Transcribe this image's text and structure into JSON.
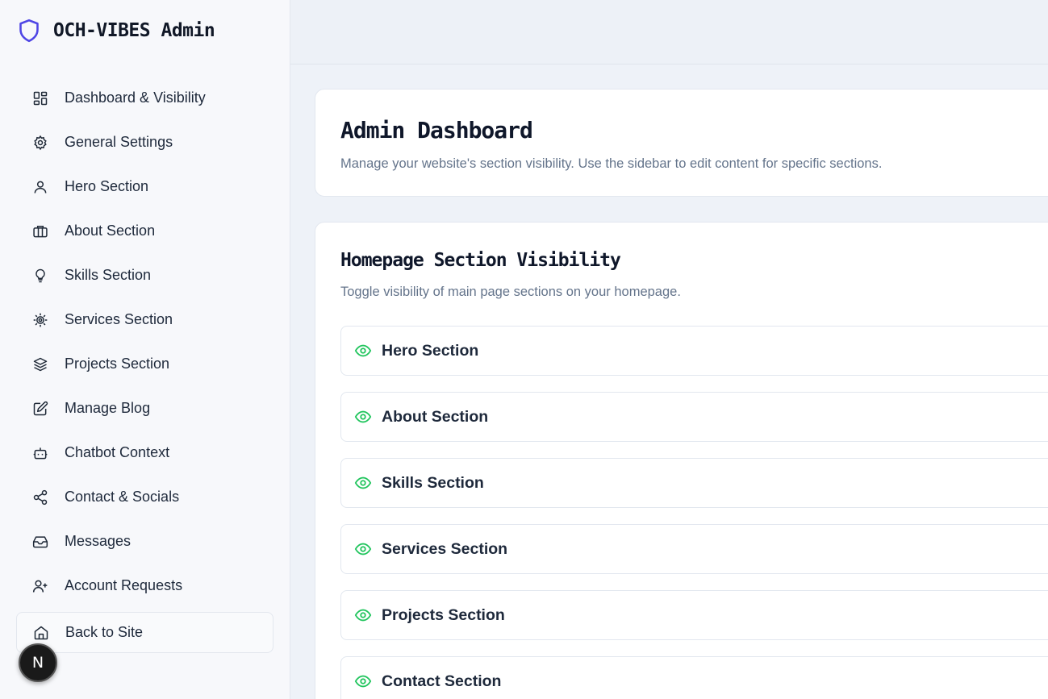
{
  "app": {
    "title": "OCH-VIBES Admin",
    "accent": "#4f46e5"
  },
  "sidebar": {
    "items": [
      {
        "label": "Dashboard & Visibility",
        "icon": "dashboard-grid-icon"
      },
      {
        "label": "General Settings",
        "icon": "gear-icon"
      },
      {
        "label": "Hero Section",
        "icon": "user-icon"
      },
      {
        "label": "About Section",
        "icon": "briefcase-icon"
      },
      {
        "label": "Skills Section",
        "icon": "lightbulb-icon"
      },
      {
        "label": "Services Section",
        "icon": "cog-icon"
      },
      {
        "label": "Projects Section",
        "icon": "layers-icon"
      },
      {
        "label": "Manage Blog",
        "icon": "edit-icon"
      },
      {
        "label": "Chatbot Context",
        "icon": "bot-icon"
      },
      {
        "label": "Contact & Socials",
        "icon": "share-icon"
      },
      {
        "label": "Messages",
        "icon": "inbox-icon"
      },
      {
        "label": "Account Requests",
        "icon": "user-plus-icon"
      }
    ],
    "back_label": "Back to Site"
  },
  "main": {
    "header": {
      "title": "Admin Dashboard",
      "subtitle": "Manage your website's section visibility. Use the sidebar to edit content for specific sections."
    },
    "visibility": {
      "title": "Homepage Section Visibility",
      "subtitle": "Toggle visibility of main page sections on your homepage.",
      "eye_color": "#22c55e",
      "sections": [
        {
          "label": "Hero Section"
        },
        {
          "label": "About Section"
        },
        {
          "label": "Skills Section"
        },
        {
          "label": "Services Section"
        },
        {
          "label": "Projects Section"
        },
        {
          "label": "Contact Section"
        }
      ]
    }
  },
  "badge": {
    "letter": "N"
  }
}
